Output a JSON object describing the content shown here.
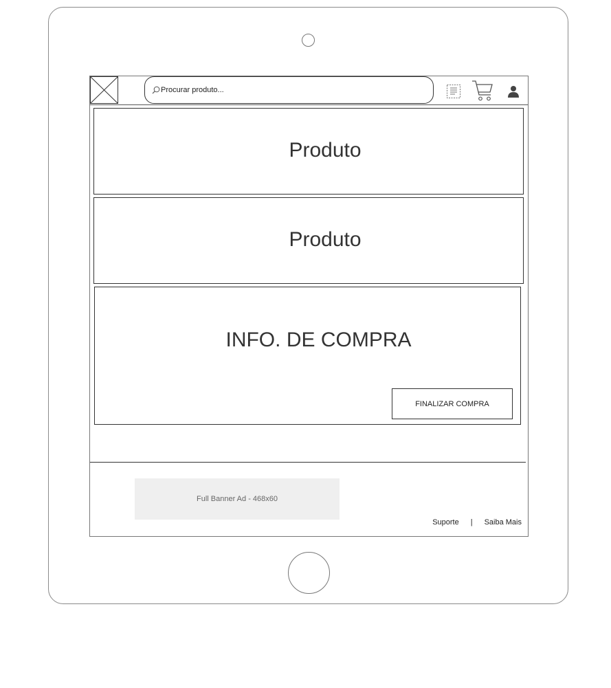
{
  "header": {
    "search": {
      "placeholder": "Procurar produto..."
    }
  },
  "products": [
    {
      "label": "Produto"
    },
    {
      "label": "Produto"
    }
  ],
  "purchase_info": {
    "title": "INFO. DE COMPRA",
    "finalize_label": "FINALIZAR COMPRA"
  },
  "footer": {
    "banner_ad": "Full Banner Ad - 468x60",
    "links": [
      "Suporte",
      "Saiba Mais"
    ],
    "separator": "|"
  },
  "icons": {
    "logo": "image-placeholder-icon",
    "search": "search-icon",
    "list": "list-icon",
    "cart": "cart-icon",
    "user": "user-icon"
  },
  "colors": {
    "border": "#333333",
    "device_outline": "#8a8a8a",
    "banner_bg": "#efefef"
  }
}
